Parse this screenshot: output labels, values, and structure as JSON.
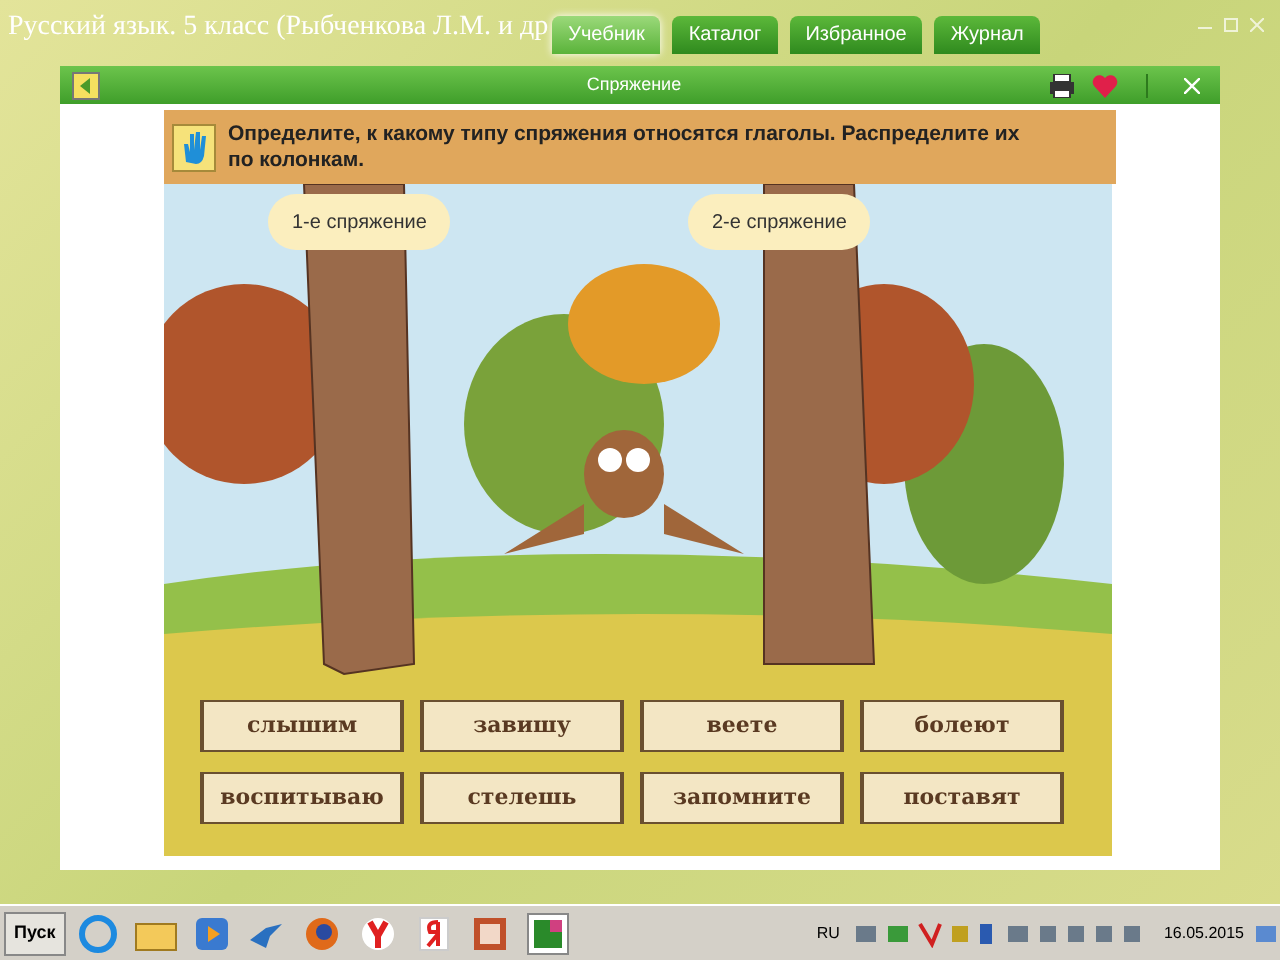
{
  "app": {
    "title": "Русский язык. 5 класс (Рыбченкова Л.М. и др"
  },
  "tabs": [
    {
      "label": "Учебник",
      "selected": true
    },
    {
      "label": "Каталог",
      "selected": false
    },
    {
      "label": "Избранное",
      "selected": false
    },
    {
      "label": "Журнал",
      "selected": false
    }
  ],
  "window": {
    "title": "Спряжение"
  },
  "instruction": "Определите, к какому типу спряжения относятся глаголы. Распределите их по колонкам.",
  "columns": [
    "1-е спряжение",
    "2-е спряжение"
  ],
  "words": [
    [
      "слышим",
      "завишу",
      "веете",
      "болеют"
    ],
    [
      "воспитываю",
      "стелешь",
      "запомните",
      "поставят"
    ]
  ],
  "taskbar": {
    "start": "Пуск",
    "language": "RU",
    "date": "16.05.2015"
  }
}
